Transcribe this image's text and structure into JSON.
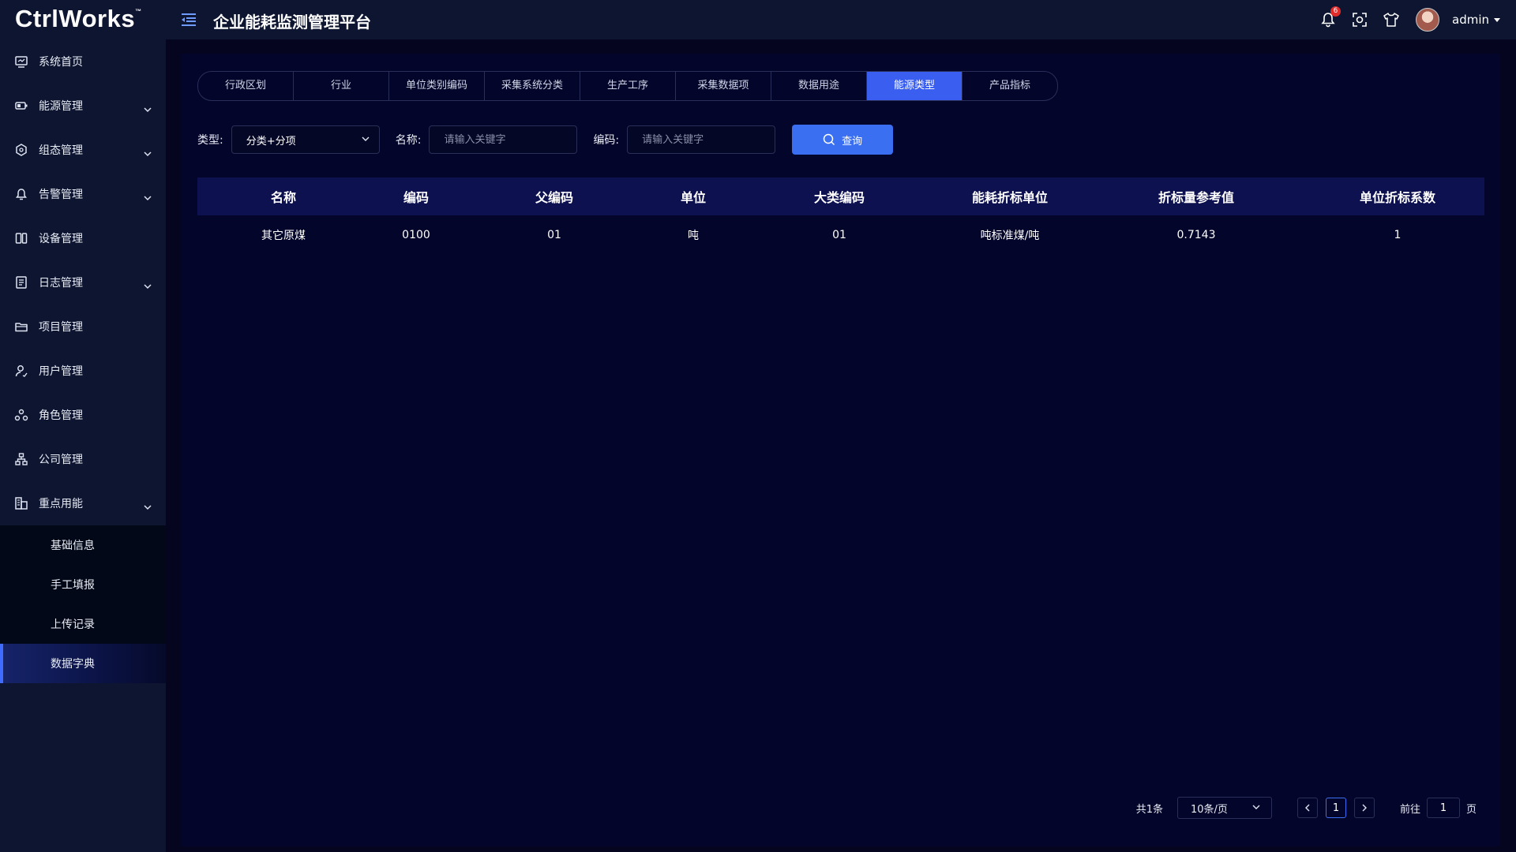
{
  "header": {
    "logo": "CtrlWorks",
    "logo_mark": "™",
    "title": "企业能耗监测管理平台",
    "notification_count": "6",
    "user": "admin"
  },
  "sidebar": {
    "items": [
      {
        "label": "系统首页",
        "icon": "monitor-icon",
        "expandable": false
      },
      {
        "label": "能源管理",
        "icon": "battery-icon",
        "expandable": true
      },
      {
        "label": "组态管理",
        "icon": "hexagon-icon",
        "expandable": true
      },
      {
        "label": "告警管理",
        "icon": "bell-icon",
        "expandable": true
      },
      {
        "label": "设备管理",
        "icon": "device-icon",
        "expandable": false
      },
      {
        "label": "日志管理",
        "icon": "log-icon",
        "expandable": true
      },
      {
        "label": "项目管理",
        "icon": "folder-icon",
        "expandable": false
      },
      {
        "label": "用户管理",
        "icon": "user-icon",
        "expandable": false
      },
      {
        "label": "角色管理",
        "icon": "role-icon",
        "expandable": false
      },
      {
        "label": "公司管理",
        "icon": "org-icon",
        "expandable": false
      },
      {
        "label": "重点用能",
        "icon": "building-icon",
        "expandable": true
      }
    ],
    "subitems": [
      {
        "label": "基础信息",
        "active": false
      },
      {
        "label": "手工填报",
        "active": false
      },
      {
        "label": "上传记录",
        "active": false
      },
      {
        "label": "数据字典",
        "active": true
      }
    ]
  },
  "tabs": [
    {
      "label": "行政区划",
      "active": false
    },
    {
      "label": "行业",
      "active": false
    },
    {
      "label": "单位类别编码",
      "active": false
    },
    {
      "label": "采集系统分类",
      "active": false
    },
    {
      "label": "生产工序",
      "active": false
    },
    {
      "label": "采集数据项",
      "active": false
    },
    {
      "label": "数据用途",
      "active": false
    },
    {
      "label": "能源类型",
      "active": true
    },
    {
      "label": "产品指标",
      "active": false
    }
  ],
  "filters": {
    "type_label": "类型:",
    "type_value": "分类+分项",
    "name_label": "名称:",
    "name_placeholder": "请输入关键字",
    "code_label": "编码:",
    "code_placeholder": "请输入关键字",
    "query_label": "查询"
  },
  "table": {
    "columns": [
      "名称",
      "编码",
      "父编码",
      "单位",
      "大类编码",
      "能耗折标单位",
      "折标量参考值",
      "单位折标系数"
    ],
    "rows": [
      [
        "其它原煤",
        "0100",
        "01",
        "吨",
        "01",
        "吨标准煤/吨",
        "0.7143",
        "1"
      ]
    ]
  },
  "pagination": {
    "total": "共1条",
    "page_size": "10条/页",
    "current_page": "1",
    "goto_label": "前往",
    "goto_value": "1",
    "page_suffix": "页"
  }
}
